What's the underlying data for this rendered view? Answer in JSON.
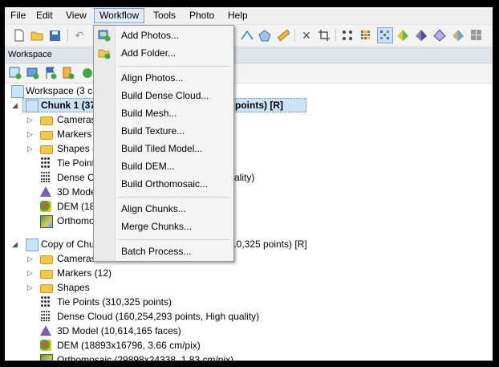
{
  "menubar": {
    "items": [
      "File",
      "Edit",
      "View",
      "Workflow",
      "Tools",
      "Photo",
      "Help"
    ],
    "active": "Workflow"
  },
  "workspace": {
    "panel_title": "Workspace",
    "root_label": "Workspace (3 ch",
    "chunk1": {
      "label_left": "Chunk 1 (37",
      "label_right": "points) [R]",
      "children": [
        {
          "icon": "folder-icon",
          "label": "Cameras"
        },
        {
          "icon": "folder-icon",
          "label": "Markers"
        },
        {
          "icon": "folder-icon",
          "label": "Shapes ("
        },
        {
          "icon": "tie-points-icon",
          "label": "Tie Points"
        },
        {
          "icon": "dense-cloud-icon",
          "label": "Dense Cl",
          "label_right": "ality)"
        },
        {
          "icon": "model-icon",
          "label": "3D Model"
        },
        {
          "icon": "dem-icon",
          "label": "DEM (18"
        },
        {
          "icon": "orthomosaic-icon",
          "label": "Orthomo"
        }
      ]
    },
    "chunk2": {
      "label_left": "Copy of Chu",
      "label_right": "10,325 points) [R]",
      "children": [
        {
          "icon": "folder-icon",
          "label": "Cameras"
        },
        {
          "icon": "folder-icon",
          "label": "Markers (12)"
        },
        {
          "icon": "folder-icon",
          "label": "Shapes"
        },
        {
          "icon": "tie-points-icon",
          "label": "Tie Points (310,325 points)"
        },
        {
          "icon": "dense-cloud-icon",
          "label": "Dense Cloud (160,254,293 points, High quality)"
        },
        {
          "icon": "model-icon",
          "label": "3D Model (10,614,165 faces)"
        },
        {
          "icon": "dem-icon",
          "label": "DEM (18893x16796, 3.66 cm/pix)"
        },
        {
          "icon": "orthomosaic-icon",
          "label": "Orthomosaic (29898x24338, 1.83 cm/pix)"
        }
      ]
    }
  },
  "workflow_menu": {
    "groups": [
      [
        "Add Photos...",
        "Add Folder..."
      ],
      [
        "Align Photos...",
        "Build Dense Cloud...",
        "Build Mesh...",
        "Build Texture...",
        "Build Tiled Model...",
        "Build DEM...",
        "Build Orthomosaic..."
      ],
      [
        "Align Chunks...",
        "Merge Chunks..."
      ],
      [
        "Batch Process..."
      ]
    ]
  },
  "colors": {
    "menu_highlight": "#dfeaf7",
    "selection": "#cde3f8",
    "folder": "#f2c84b",
    "model": "#7b5fb3"
  }
}
